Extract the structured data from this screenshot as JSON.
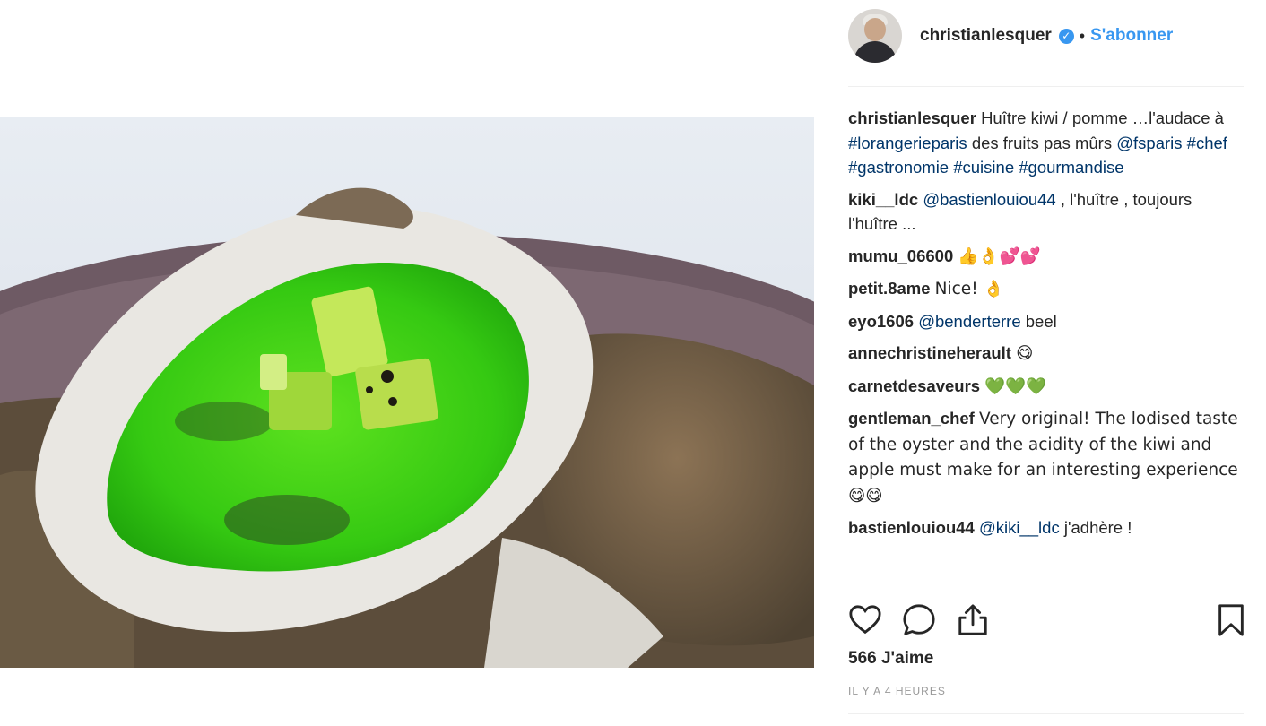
{
  "header": {
    "username": "christianlesquer",
    "separator": "•",
    "follow_label": "S'abonner"
  },
  "caption": {
    "user": "christianlesquer",
    "text_1": "Huître kiwi / pomme …l'audace à",
    "tag_1": "#lorangerieparis",
    "text_2": "des fruits pas mûrs",
    "tag_2": "@fsparis",
    "tag_3": "#chef",
    "tag_4": "#gastronomie",
    "tag_5": "#cuisine",
    "tag_6": "#gourmandise"
  },
  "comments": [
    {
      "user": "kiki__ldc",
      "mention": "@bastienlouiou44",
      "text": ", l'huître , toujours l'huître ..."
    },
    {
      "user": "mumu_06600",
      "text": "👍👌💕💕"
    },
    {
      "user": "petit.8ame",
      "text": "Nice! 👌"
    },
    {
      "user": "eyo1606",
      "mention": "@benderterre",
      "text": "beel"
    },
    {
      "user": "annechristineherault",
      "text": "😋"
    },
    {
      "user": "carnetdesaveurs",
      "text": "💚💚💚"
    },
    {
      "user": "gentleman_chef",
      "text": "Very original! The lodised taste of the oyster and the acidity of the kiwi and apple must make for an interesting experience 😋😋"
    },
    {
      "user": "bastienlouiou44",
      "mention": "@kiki__ldc",
      "text": "j'adhère !"
    }
  ],
  "icons": {
    "like": "heart-icon",
    "comment": "comment-bubble-icon",
    "share": "share-icon",
    "save": "bookmark-icon"
  },
  "likes_label": "566 J'aime",
  "timestamp": "IL Y A 4 HEURES",
  "colors": {
    "accent_blue": "#3897f0",
    "hashtag": "#003569",
    "oyster_green": "#3fd11a"
  }
}
